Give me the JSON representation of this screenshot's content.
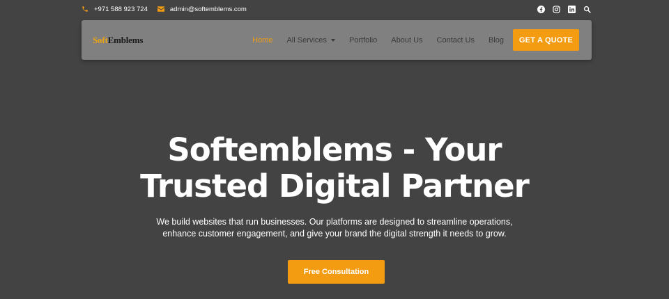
{
  "topbar": {
    "phone": "+971 588 923 724",
    "email": "admin@softemblems.com",
    "socials": [
      "facebook-icon",
      "instagram-icon",
      "linkedin-icon",
      "search-icon"
    ]
  },
  "brand": {
    "logo_part1": "Soft",
    "logo_part2": "Emblems"
  },
  "nav": {
    "items": [
      {
        "label": "Home",
        "active": true
      },
      {
        "label": "All Services",
        "dropdown": true
      },
      {
        "label": "Portfolio"
      },
      {
        "label": "About Us"
      },
      {
        "label": "Contact Us"
      },
      {
        "label": "Blog"
      }
    ],
    "cta_label": "GET A QUOTE"
  },
  "hero": {
    "title_line1": "Softemblems - Your",
    "title_line2": "Trusted Digital Partner",
    "subtitle_line1": "We build websites that run businesses. Our platforms are designed to streamline operations,",
    "subtitle_line2": "enhance customer engagement, and give your brand the digital strength it needs to grow.",
    "button_label": "Free Consultation"
  },
  "colors": {
    "accent": "#f39c12",
    "background": "#434343",
    "navbar": "#808080"
  }
}
